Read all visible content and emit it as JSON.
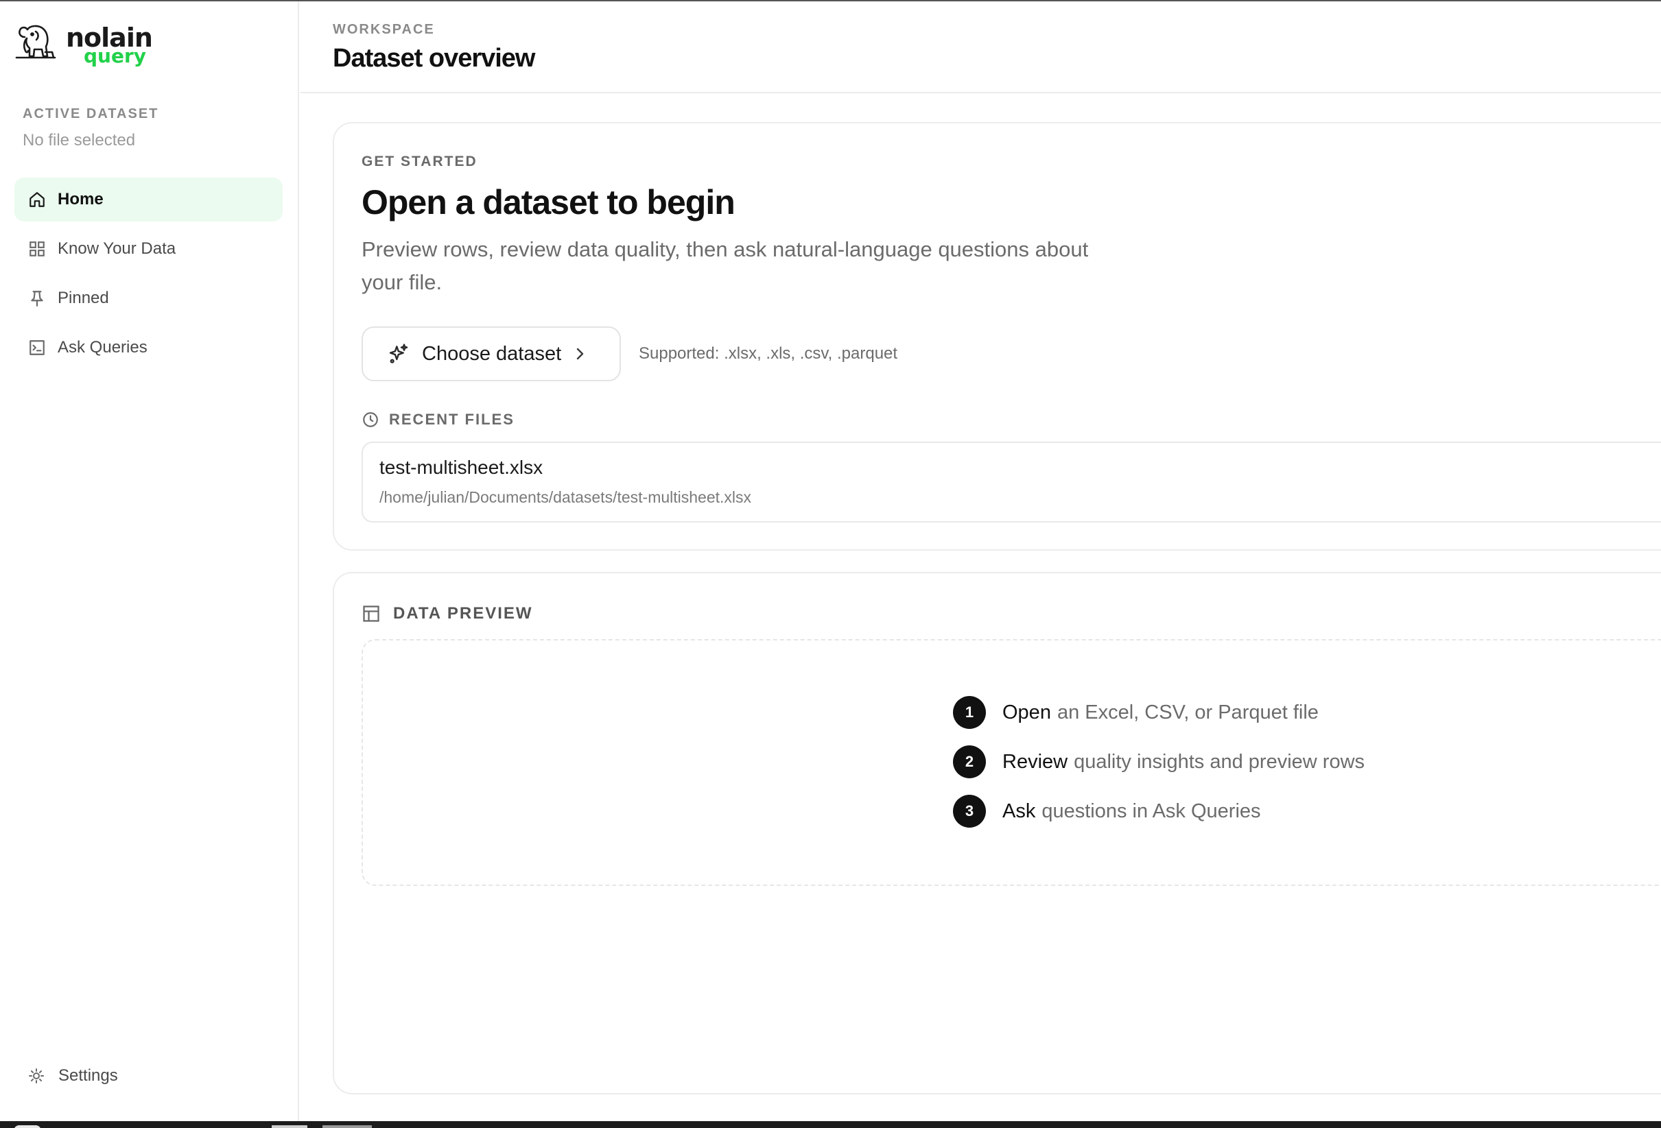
{
  "brand": {
    "name": "nolain",
    "sub": "query",
    "icon": "elephant-logo-icon",
    "accent_color": "#22d14a"
  },
  "sidebar": {
    "active_dataset_label": "ACTIVE DATASET",
    "active_dataset_value": "No file selected",
    "items": [
      {
        "label": "Home",
        "icon": "home-icon",
        "active": true
      },
      {
        "label": "Know Your Data",
        "icon": "grid-icon",
        "active": false
      },
      {
        "label": "Pinned",
        "icon": "pin-icon",
        "active": false
      },
      {
        "label": "Ask Queries",
        "icon": "terminal-icon",
        "active": false
      }
    ],
    "settings_label": "Settings",
    "settings_icon": "gear-icon",
    "active_bg_color": "#ebfbef"
  },
  "header": {
    "eyebrow": "WORKSPACE",
    "title": "Dataset overview"
  },
  "get_started": {
    "label": "GET STARTED",
    "title": "Open a dataset to begin",
    "description": "Preview rows, review data quality, then ask natural-language questions about your file.",
    "choose_button_label": "Choose dataset",
    "supported_text": "Supported: .xlsx, .xls, .csv, .parquet",
    "recent_files_label": "RECENT FILES",
    "recent_files": [
      {
        "name": "test-multisheet.xlsx",
        "path": "/home/julian/Documents/datasets/test-multisheet.xlsx"
      }
    ]
  },
  "data_preview": {
    "label": "DATA PREVIEW",
    "steps": [
      {
        "number": "1",
        "strong": "Open",
        "rest": "an Excel, CSV, or Parquet file"
      },
      {
        "number": "2",
        "strong": "Review",
        "rest": "quality insights and preview rows"
      },
      {
        "number": "3",
        "strong": "Ask",
        "rest": "questions in Ask Queries"
      }
    ]
  }
}
